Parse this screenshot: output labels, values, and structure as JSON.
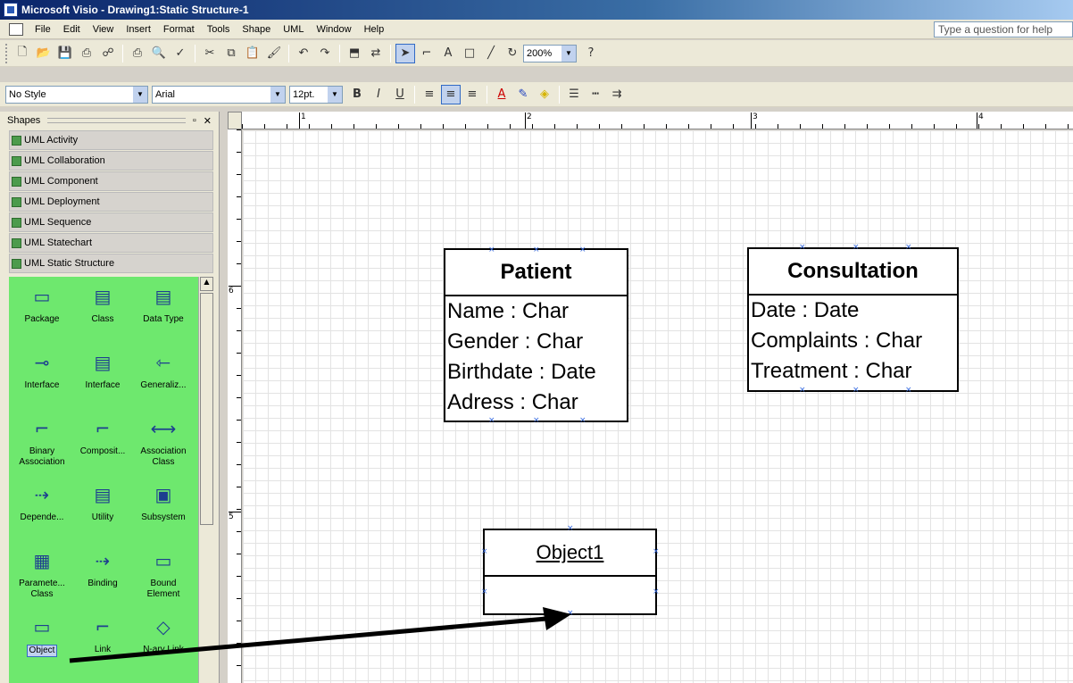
{
  "window": {
    "title": "Microsoft Visio - Drawing1:Static Structure-1"
  },
  "menu": {
    "items": [
      "File",
      "Edit",
      "View",
      "Insert",
      "Format",
      "Tools",
      "Shape",
      "UML",
      "Window",
      "Help"
    ],
    "ask_placeholder": "Type a question for help"
  },
  "toolbar": {
    "zoom": "200%"
  },
  "format": {
    "style": "No Style",
    "font": "Arial",
    "size": "12pt."
  },
  "shapes_panel": {
    "title": "Shapes",
    "stencils": [
      "UML Activity",
      "UML Collaboration",
      "UML Component",
      "UML Deployment",
      "UML Sequence",
      "UML Statechart",
      "UML Static Structure"
    ],
    "masters": [
      {
        "label": "Package",
        "icon": "package-icon"
      },
      {
        "label": "Class",
        "icon": "class-icon"
      },
      {
        "label": "Data Type",
        "icon": "data-type-icon"
      },
      {
        "label": "Interface",
        "icon": "interface-lollipop-icon"
      },
      {
        "label": "Interface",
        "icon": "interface-icon"
      },
      {
        "label": "Generaliz...",
        "icon": "generalization-icon"
      },
      {
        "label": "Binary\nAssociation",
        "icon": "binary-association-icon"
      },
      {
        "label": "Composit...",
        "icon": "composition-icon"
      },
      {
        "label": "Association\nClass",
        "icon": "association-class-icon"
      },
      {
        "label": "Depende...",
        "icon": "dependency-icon"
      },
      {
        "label": "Utility",
        "icon": "utility-icon"
      },
      {
        "label": "Subsystem",
        "icon": "subsystem-icon"
      },
      {
        "label": "Paramete...\nClass",
        "icon": "parameterized-class-icon"
      },
      {
        "label": "Binding",
        "icon": "binding-icon"
      },
      {
        "label": "Bound\nElement",
        "icon": "bound-element-icon"
      },
      {
        "label": "Object",
        "icon": "object-icon"
      },
      {
        "label": "Link",
        "icon": "link-icon"
      },
      {
        "label": "N-ary Link",
        "icon": "n-ary-link-icon"
      }
    ]
  },
  "rulers": {
    "horizontal": [
      "1",
      "2",
      "3",
      "4"
    ],
    "vertical": [
      "6",
      "5"
    ]
  },
  "diagram": {
    "patient": {
      "name": "Patient",
      "attributes": [
        "Name : Char",
        "Gender : Char",
        "Birthdate : Date",
        "Adress : Char"
      ]
    },
    "consultation": {
      "name": "Consultation",
      "attributes": [
        "Date : Date",
        "Complaints : Char",
        "Treatment : Char"
      ]
    },
    "object": {
      "name": "Object1"
    }
  }
}
